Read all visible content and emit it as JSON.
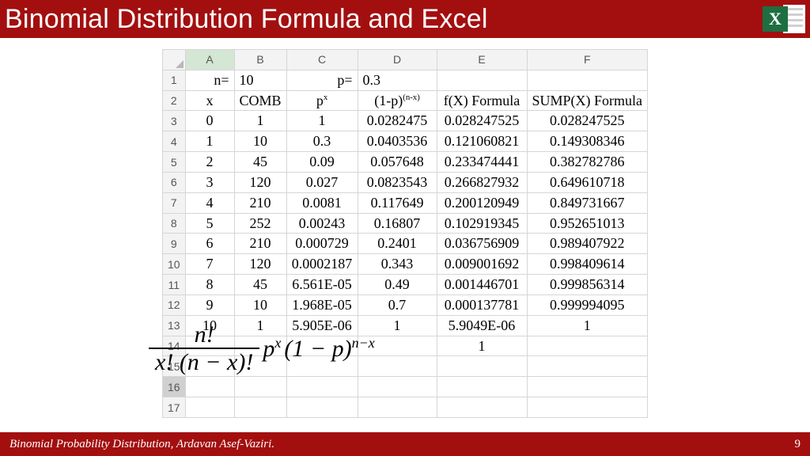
{
  "title": "Binomial Distribution Formula and Excel",
  "footer_text": "Binomial Probability Distribution, Ardavan Asef-Vaziri.",
  "page_number": "9",
  "excel_letter": "X",
  "sheet": {
    "columns": [
      "A",
      "B",
      "C",
      "D",
      "E",
      "F"
    ],
    "active_col": "A",
    "active_row": "16",
    "row1": {
      "A_label": "n=",
      "A_value": "10",
      "C_label": "p=",
      "C_value": "0.3"
    },
    "headers": {
      "A": "x",
      "B": "COMB",
      "C_p": "p",
      "C_exp": "x",
      "D_base": "(1-p)",
      "D_exp": "(n-x)",
      "E": "f(X) Formula",
      "F": "SUMP(X) Formula"
    },
    "rows": [
      {
        "r": "3",
        "x": "0",
        "comb": "1",
        "px": "1",
        "qnx": "0.0282475",
        "fx": "0.028247525",
        "sump": "0.028247525"
      },
      {
        "r": "4",
        "x": "1",
        "comb": "10",
        "px": "0.3",
        "qnx": "0.0403536",
        "fx": "0.121060821",
        "sump": "0.149308346"
      },
      {
        "r": "5",
        "x": "2",
        "comb": "45",
        "px": "0.09",
        "qnx": "0.057648",
        "fx": "0.233474441",
        "sump": "0.382782786"
      },
      {
        "r": "6",
        "x": "3",
        "comb": "120",
        "px": "0.027",
        "qnx": "0.0823543",
        "fx": "0.266827932",
        "sump": "0.649610718"
      },
      {
        "r": "7",
        "x": "4",
        "comb": "210",
        "px": "0.0081",
        "qnx": "0.117649",
        "fx": "0.200120949",
        "sump": "0.849731667"
      },
      {
        "r": "8",
        "x": "5",
        "comb": "252",
        "px": "0.00243",
        "qnx": "0.16807",
        "fx": "0.102919345",
        "sump": "0.952651013"
      },
      {
        "r": "9",
        "x": "6",
        "comb": "210",
        "px": "0.000729",
        "qnx": "0.2401",
        "fx": "0.036756909",
        "sump": "0.989407922"
      },
      {
        "r": "10",
        "x": "7",
        "comb": "120",
        "px": "0.0002187",
        "qnx": "0.343",
        "fx": "0.009001692",
        "sump": "0.998409614"
      },
      {
        "r": "11",
        "x": "8",
        "comb": "45",
        "px": "6.561E-05",
        "qnx": "0.49",
        "fx": "0.001446701",
        "sump": "0.999856314"
      },
      {
        "r": "12",
        "x": "9",
        "comb": "10",
        "px": "1.968E-05",
        "qnx": "0.7",
        "fx": "0.000137781",
        "sump": "0.999994095"
      },
      {
        "r": "13",
        "x": "10",
        "comb": "1",
        "px": "5.905E-06",
        "qnx": "1",
        "fx": "5.9049E-06",
        "sump": "1"
      }
    ],
    "empty_rows": [
      "14",
      "15",
      "16",
      "17"
    ],
    "row14_value": "1"
  },
  "formula": {
    "frac_num": "n!",
    "frac_den_1": "x!",
    "frac_den_2": "(n − x)!",
    "p_base": "p",
    "p_exp": "x",
    "q_base": "(1 − p)",
    "q_exp": "n−x"
  }
}
